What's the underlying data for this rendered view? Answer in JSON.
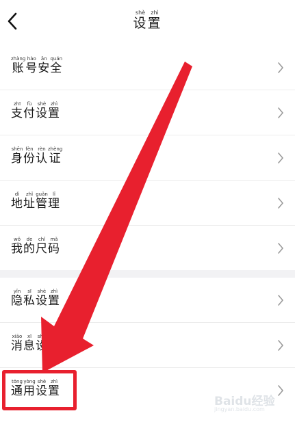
{
  "header": {
    "title": "设置",
    "title_pinyin": [
      "shè",
      "zhì"
    ]
  },
  "settings": {
    "group1": [
      {
        "label": "账号安全",
        "pinyin": [
          "zhàng",
          "hào",
          "ān",
          "quán"
        ]
      },
      {
        "label": "支付设置",
        "pinyin": [
          "zhī",
          "fù",
          "shè",
          "zhì"
        ]
      },
      {
        "label": "身份认证",
        "pinyin": [
          "shēn",
          "fèn",
          "rèn",
          "zhèng"
        ]
      },
      {
        "label": "地址管理",
        "pinyin": [
          "dì",
          "zhǐ",
          "guǎn",
          "lǐ"
        ]
      },
      {
        "label": "我的尺码",
        "pinyin": [
          "wǒ",
          "de",
          "chǐ",
          "mǎ"
        ]
      }
    ],
    "group2": [
      {
        "label": "隐私设置",
        "pinyin": [
          "yǐn",
          "sī",
          "shè",
          "zhì"
        ]
      },
      {
        "label": "消息设置",
        "pinyin": [
          "xiāo",
          "xī",
          "shè",
          "zhì"
        ]
      },
      {
        "label": "通用设置",
        "pinyin": [
          "tōng",
          "yòng",
          "shè",
          "zhì"
        ]
      }
    ]
  },
  "annotation": {
    "color": "#e8202e",
    "highlighted_item": "通用设置"
  },
  "watermark": {
    "main": "Baidu经验",
    "sub": "jingyan.baidu.com"
  }
}
